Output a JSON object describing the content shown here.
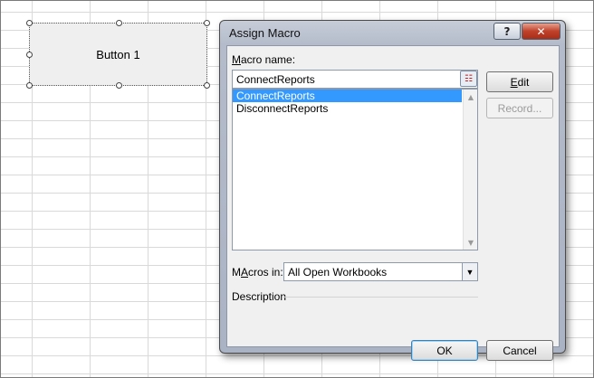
{
  "sheet": {
    "button_label": "Button 1"
  },
  "dialog": {
    "title": "Assign Macro",
    "help_glyph": "?",
    "close_glyph": "✕",
    "macro_name_label_accel": "M",
    "macro_name_label_rest": "acro name:",
    "macro_name_value": "ConnectReports",
    "ref_icon_glyph": "☷",
    "macros": [
      {
        "name": "ConnectReports",
        "selected": true
      },
      {
        "name": "DisconnectReports",
        "selected": false
      }
    ],
    "scroll_up_glyph": "▲",
    "scroll_down_glyph": "▼",
    "edit_accel": "E",
    "edit_rest": "dit",
    "record_label": "Record...",
    "macros_in_accel": "A",
    "macros_in_label_pre": "M",
    "macros_in_label_post": "cros in:",
    "macros_in_value": "All Open Workbooks",
    "dropdown_glyph": "▼",
    "description_label": "Description",
    "ok_label": "OK",
    "cancel_label": "Cancel"
  }
}
